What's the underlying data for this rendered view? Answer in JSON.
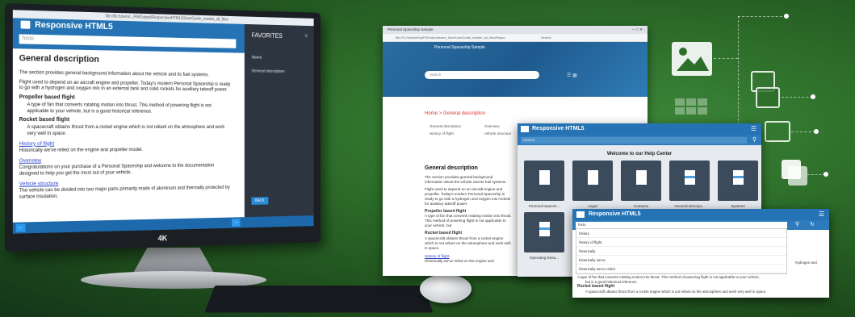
{
  "monitor": {
    "window_url": "file:///E:/Users/.../FMOutput/ResponsiveHTML5/UserGuide_master_all_files",
    "app_title": "Responsive HTML5",
    "search_value": "histo",
    "search_placeholder": "Search",
    "heading": "General description",
    "intro": "The section provides general background information about the vehicle and its fuel systems.",
    "para1": "Flight used to depend on an aircraft engine and propeller. Today's modern Personal Spaceship is ready to go with a hydrogen and oxygen mix in an external tank and solid rockets for auxiliary takeoff power.",
    "sub1_title": "Propeller based flight",
    "sub1_text": "A type of fan that converts rotating motion into thrust. This method of powering flight is not applicable to your vehicle, but is a good historical reference.",
    "sub2_title": "Rocket based flight",
    "sub2_text": "A spacecraft obtains thrust from a rocket engine which is not reliant on the atmosphere and work very well in space.",
    "link1": "History of flight",
    "link1_text": "Historically we've relied on the engine and propeller model.",
    "link2": "Overview",
    "link2_text": "Congratulations on your purchase of a Personal Spaceship and welcome to the documentation designed to help you get the most out of your vehicle.",
    "link3": "Vehicle structure",
    "link3_text": "The vehicle can be divided into two major parts primarily made of aluminum and thermally protected by surface insulation.",
    "favorites_title": "FAVORITES",
    "favorites_sub": "Name",
    "favorites_item": "General description",
    "back_label": "BACK",
    "brand_4k": "4K"
  },
  "browser": {
    "tab_label": "Personal Spaceship Sample",
    "address": "file:///C:/Users/tmp/FMOutput/azure_blue/UserGuide_master_all_files/Respo",
    "search_hint": "Search",
    "brand": "Personal Spaceship Sample",
    "search_placeholder": "Search",
    "breadcrumb_home": "Home",
    "breadcrumb_sep": ">",
    "breadcrumb_current": "General description",
    "toc": [
      "General description",
      "History of flight"
    ],
    "toc2": [
      "Overview",
      "Vehicle structure"
    ],
    "heading": "General description",
    "p1": "The section provides general background information about the vehicle and its fuel systems.",
    "p2": "Flight used to depend on an aircraft engine and propeller. Today's modern Personal Spaceship is ready to go with a hydrogen and oxygen mix rockets for auxiliary takeoff power.",
    "sub1": "Propeller based flight",
    "sub1_text": "A type of fan that converts rotating motion into thrust. This method of powering flight is not applicable to your vehicle, but",
    "sub2": "Rocket based flight",
    "sub2_text": "A spacecraft obtains thrust from a rocket engine which is not reliant on the atmosphere and work well in space.",
    "link": "History of flight",
    "link_text": "Historically we've relied on the engine and"
  },
  "help": {
    "title": "Responsive HTML5",
    "search_placeholder": "Search",
    "welcome": "Welcome to our Help Center",
    "tiles": [
      "Personal Spaces...",
      "Legal",
      "Contacts",
      "General descript...",
      "Systems",
      "Operating limita..."
    ]
  },
  "dropdown": {
    "title": "Responsive HTML5",
    "input": "histo",
    "items": [
      "history",
      "history of flight",
      "historically",
      "historically we've",
      "historically we've relied"
    ],
    "right_fragment": "hydrogen and",
    "body1": "A type of fan that converts rotating motion into thrust. This method of powering flight is not applicable to your vehicle,",
    "body2": "but is a good historical reference.",
    "sub": "Rocket based flight",
    "body3": "A spacecraft obtains thrust from a rocket engine which is not reliant on the atmosphere and work very well in space."
  }
}
